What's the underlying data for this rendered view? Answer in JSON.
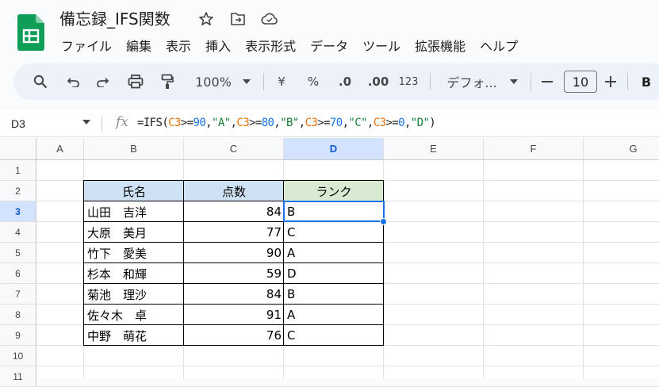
{
  "document": {
    "title": "備忘録_IFS関数"
  },
  "menu": [
    "ファイル",
    "編集",
    "表示",
    "挿入",
    "表示形式",
    "データ",
    "ツール",
    "拡張機能",
    "ヘルプ"
  ],
  "toolbar": {
    "zoom": "100%",
    "currency": "¥",
    "percent": "%",
    "decimal_decrease": ".0",
    "decimal_increase": ".00",
    "number_format": "123",
    "font": "デフォ...",
    "font_size": "10",
    "bold": "B"
  },
  "formula_bar": {
    "name_box": "D3",
    "fx": "fx",
    "formula_parts": [
      {
        "t": "=IFS(",
        "k": "plain"
      },
      {
        "t": "C3",
        "k": "ref"
      },
      {
        "t": ">=",
        "k": "plain"
      },
      {
        "t": "90",
        "k": "num"
      },
      {
        "t": ",",
        "k": "plain"
      },
      {
        "t": "\"A\"",
        "k": "str"
      },
      {
        "t": ",",
        "k": "plain"
      },
      {
        "t": "C3",
        "k": "ref"
      },
      {
        "t": ">=",
        "k": "plain"
      },
      {
        "t": "80",
        "k": "num"
      },
      {
        "t": ",",
        "k": "plain"
      },
      {
        "t": "\"B\"",
        "k": "str"
      },
      {
        "t": ",",
        "k": "plain"
      },
      {
        "t": "C3",
        "k": "ref"
      },
      {
        "t": ">=",
        "k": "plain"
      },
      {
        "t": "70",
        "k": "num"
      },
      {
        "t": ",",
        "k": "plain"
      },
      {
        "t": "\"C\"",
        "k": "str"
      },
      {
        "t": ",",
        "k": "plain"
      },
      {
        "t": "C3",
        "k": "ref"
      },
      {
        "t": ">=",
        "k": "plain"
      },
      {
        "t": "0",
        "k": "num"
      },
      {
        "t": ",",
        "k": "plain"
      },
      {
        "t": "\"D\"",
        "k": "str"
      },
      {
        "t": ")",
        "k": "plain"
      }
    ]
  },
  "grid": {
    "columns": [
      "A",
      "B",
      "C",
      "D",
      "E",
      "F",
      "G"
    ],
    "selected_column": "D",
    "rows": [
      "1",
      "2",
      "3",
      "4",
      "5",
      "6",
      "7",
      "8",
      "9",
      "10",
      "11"
    ],
    "selected_row": "3",
    "table_headers": [
      "氏名",
      "点数",
      "ランク"
    ],
    "header_colors": [
      "#cfe2f3",
      "#cfe2f3",
      "#d9ead3"
    ],
    "table_rows": [
      {
        "name": "山田　吉洋",
        "score": "84",
        "rank": "B"
      },
      {
        "name": "大原　美月",
        "score": "77",
        "rank": "C"
      },
      {
        "name": "竹下　愛美",
        "score": "90",
        "rank": "A"
      },
      {
        "name": "杉本　和輝",
        "score": "59",
        "rank": "D"
      },
      {
        "name": "菊池　理沙",
        "score": "84",
        "rank": "B"
      },
      {
        "name": "佐々木　卓",
        "score": "91",
        "rank": "A"
      },
      {
        "name": "中野　萌花",
        "score": "76",
        "rank": "C"
      }
    ]
  }
}
